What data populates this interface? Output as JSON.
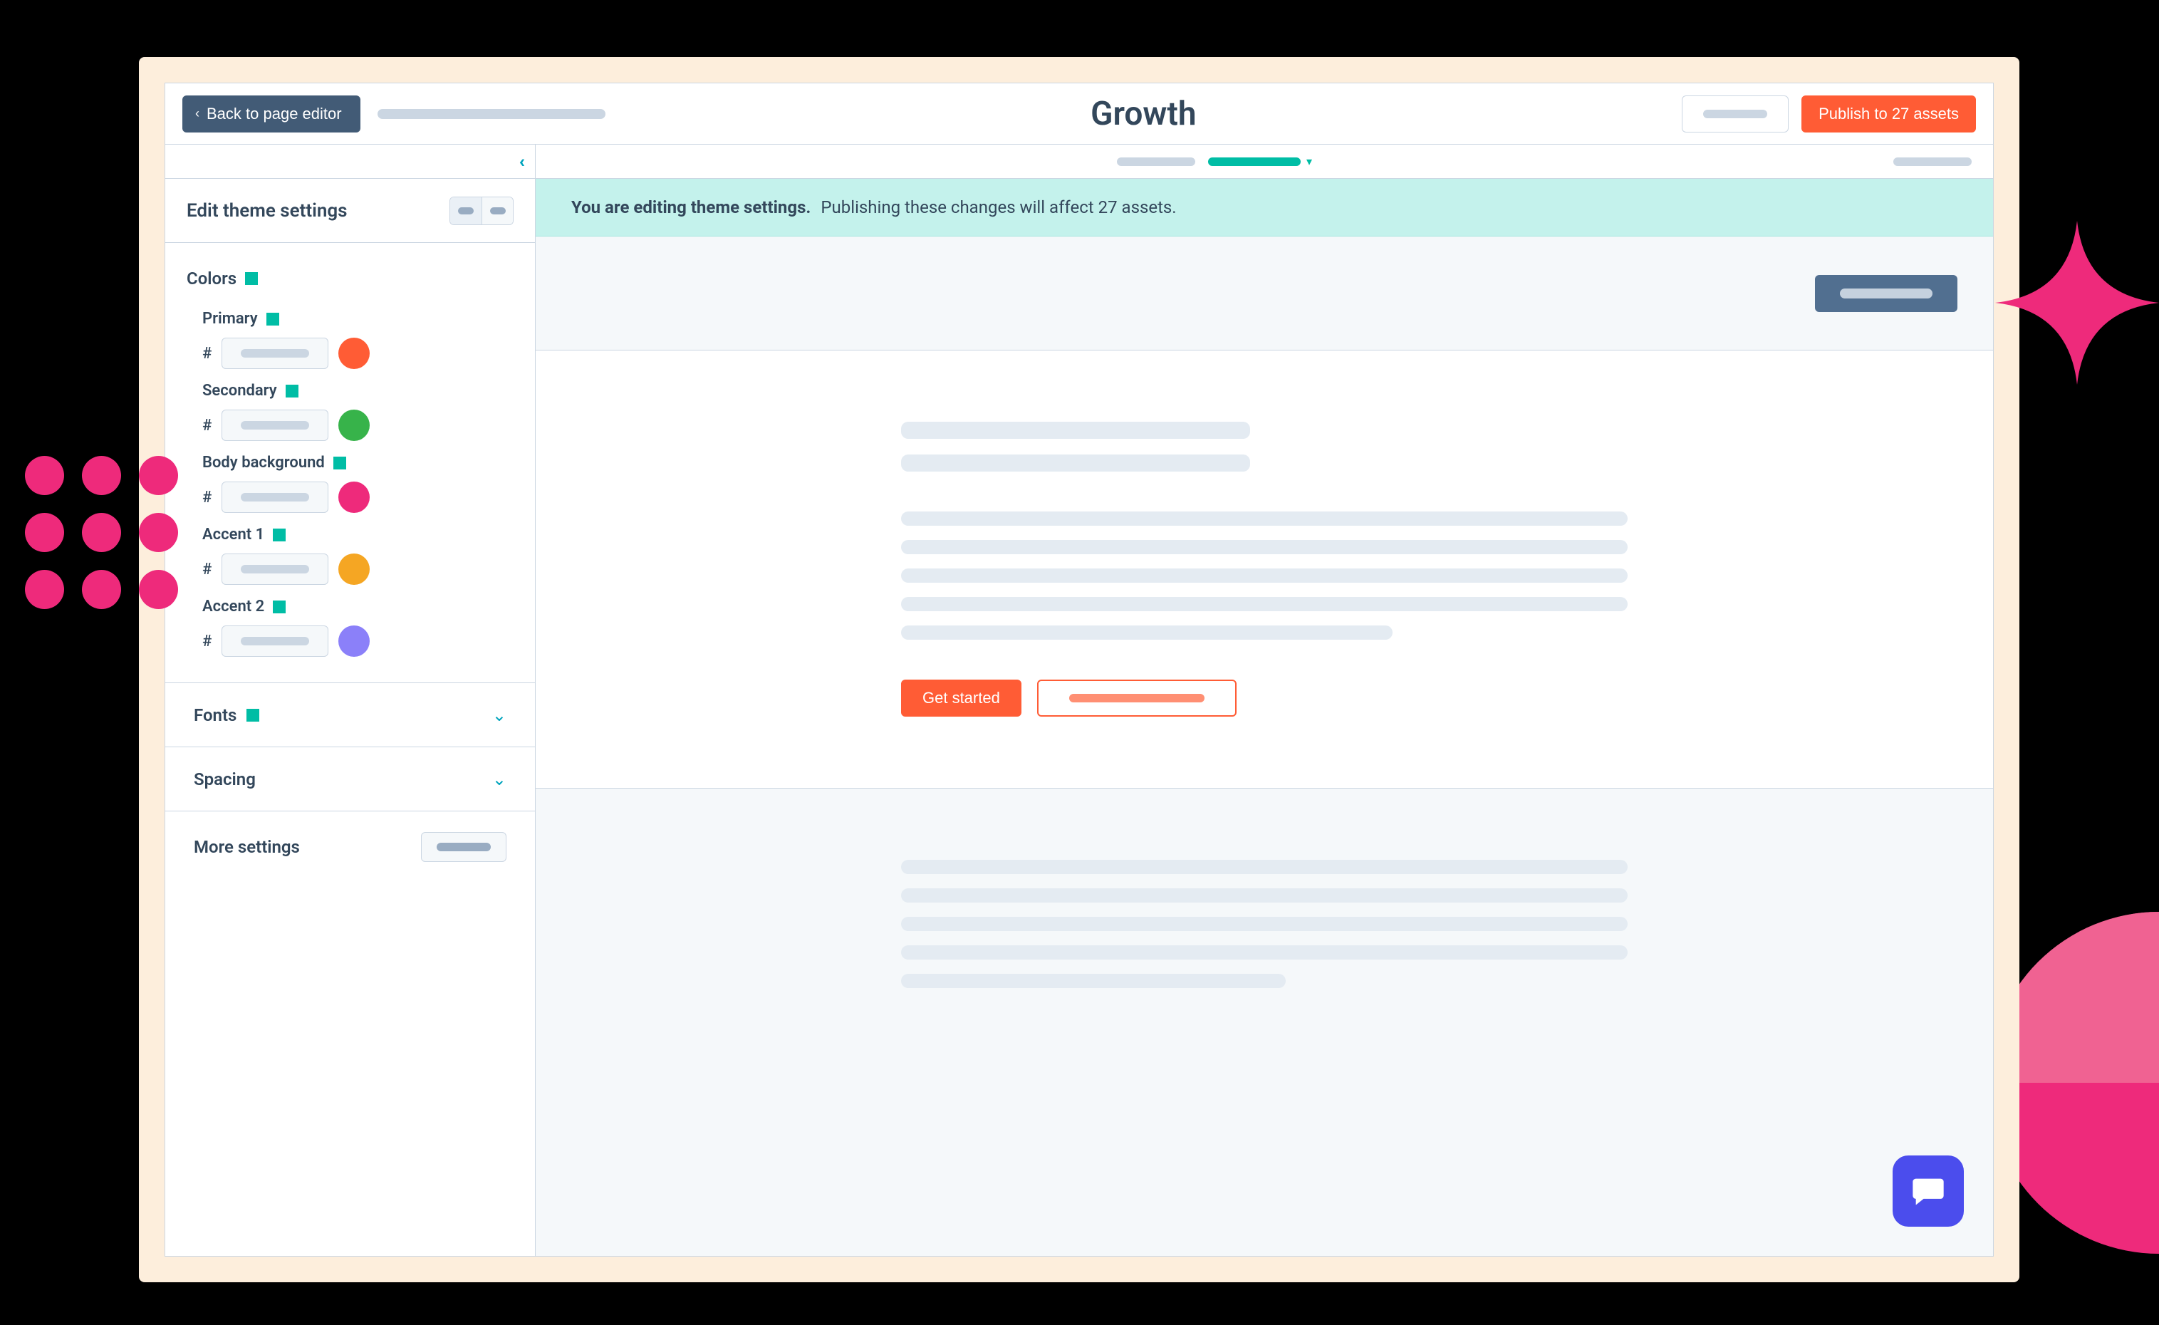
{
  "topbar": {
    "back_label": "Back to page editor",
    "title": "Growth",
    "publish_label": "Publish to 27 assets"
  },
  "sidebar": {
    "edit_title": "Edit theme settings",
    "colors_label": "Colors",
    "colors": [
      {
        "label": "Primary",
        "swatch": "#ff5c35"
      },
      {
        "label": "Secondary",
        "swatch": "#37b34a"
      },
      {
        "label": "Body background",
        "swatch": "#ee2a7b"
      },
      {
        "label": "Accent 1",
        "swatch": "#f5a623"
      },
      {
        "label": "Accent 2",
        "swatch": "#8b80f9"
      }
    ],
    "fonts_label": "Fonts",
    "spacing_label": "Spacing",
    "more_label": "More settings"
  },
  "banner": {
    "bold": "You are editing theme settings.",
    "regular": "Publishing these changes will affect 27 assets."
  },
  "preview": {
    "cta_primary": "Get started"
  }
}
